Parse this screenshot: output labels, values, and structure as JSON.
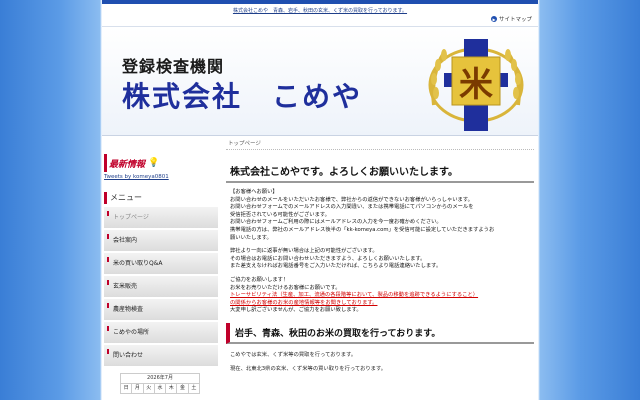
{
  "tagline": "株式会社こめや　青森、岩手、秋田の玄米、くず米の買取を行っております。",
  "sitemap_label": "サイトマップ",
  "header": {
    "sub": "登録検査機関",
    "title": "株式会社　こめや",
    "logo_char": "米"
  },
  "sidebar": {
    "news_title": "最新情報",
    "tweets_link": "Tweets by komeya0801",
    "menu_title": "メニュー",
    "items": [
      {
        "label": "トップページ"
      },
      {
        "label": "会社案内"
      },
      {
        "label": "米の買い取りQ&A"
      },
      {
        "label": "玄米販売"
      },
      {
        "label": "農産物検査"
      },
      {
        "label": "こめやの場所"
      },
      {
        "label": "問い合わせ"
      }
    ],
    "calendar": {
      "title": "2026年7月",
      "days": [
        "日",
        "月",
        "火",
        "水",
        "木",
        "金",
        "土"
      ]
    }
  },
  "content": {
    "breadcrumb": "トップページ",
    "heading": "株式会社こめやです。よろしくお願いいたします。",
    "notice_title": "【お客様へお願い】",
    "notice_lines": [
      "お問い合わせのメールをいただいたお客様で、弊社からの返信ができないお客様がいらっしゃいます。",
      "お問い合わせフォームでのメールアドレスの入力間違い、または携帯電話にてパソコンからのメールを",
      "受信拒否されている可能性がございます。",
      "お問い合わせフォームご利用の際にはメールアドレスの入力を今一度お確かめください。",
      "携帯電話の方は、弊社のメールアドレス後半の「kk-komeya.com」を受信可能に設定していただきますようお",
      "願いいたします。"
    ],
    "reply_lines": [
      "弊社より一向に返事が無い場合は上記の可能性がございます。",
      "その場合はお電話にお問い合わせいただきますよう、よろしくお願いいたします。",
      "また差支えなければお電話番号をご入力いただければ、こちらより電話連絡いたします。"
    ],
    "coop_lines": [
      "ご協力をお願いします！",
      "お米をお売りいただけるお客様にお願いです。"
    ],
    "trace_line": "トレーサビリティ法（生産、加工、流通の各段階等において、製品の移動を追跡できるようにすること）",
    "coop_lines2": [
      "の関係からお客様のお米の産地情報等をお聞きしております。",
      "大変申し訳ございませんが、ご協力をお願い致します。"
    ],
    "heading2": "岩手、青森、秋田のお米の買取を行っております。",
    "bottom_text": "こめやでは玄米、くず米等の買取を行っております。",
    "bottom_text2": "現在、北東北3県の玄米、くず米等の買い取りを行っております。"
  },
  "colors": {
    "accent_red": "#c0002a",
    "brand_blue": "#1f2f9c"
  }
}
